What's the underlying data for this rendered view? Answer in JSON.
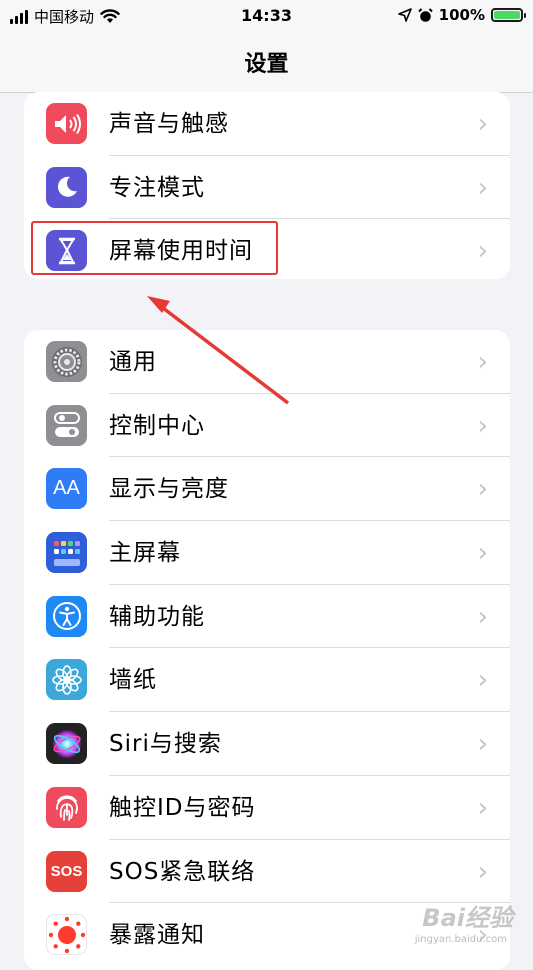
{
  "status_bar": {
    "carrier": "中国移动",
    "time": "14:33",
    "battery": "100%",
    "battery_level": 1.0
  },
  "nav": {
    "title": "设置"
  },
  "group1": [
    {
      "label": "声音与触感",
      "icon": "speaker-icon",
      "color": "#ef4b5c"
    },
    {
      "label": "专注模式",
      "icon": "moon-icon",
      "color": "#5b55d6"
    },
    {
      "label": "屏幕使用时间",
      "icon": "hourglass-icon",
      "color": "#5b55d6"
    }
  ],
  "group2": [
    {
      "label": "通用",
      "icon": "gear-icon",
      "color": "#8e8e93"
    },
    {
      "label": "控制中心",
      "icon": "toggles-icon",
      "color": "#8e8e93"
    },
    {
      "label": "显示与亮度",
      "icon": "aa-icon",
      "icon_text": "AA",
      "color": "#2f7cf6"
    },
    {
      "label": "主屏幕",
      "icon": "home-grid-icon",
      "color": "#2f5fd8"
    },
    {
      "label": "辅助功能",
      "icon": "accessibility-icon",
      "color": "#1e88f5"
    },
    {
      "label": "墙纸",
      "icon": "flower-icon",
      "color": "#3ca7d9"
    },
    {
      "label": "Siri与搜索",
      "icon": "siri-icon",
      "color": "#222222"
    },
    {
      "label": "触控ID与密码",
      "icon": "fingerprint-icon",
      "color": "#ef4b5c"
    },
    {
      "label": "SOS紧急联络",
      "icon": "sos-icon",
      "icon_text": "SOS",
      "color": "#e5413a"
    },
    {
      "label": "暴露通知",
      "icon": "exposure-icon",
      "color": "#ffffff"
    }
  ],
  "annotation": {
    "color": "#e53935"
  },
  "watermark": {
    "text": "Bai经验",
    "url": "jingyan.baidu.com"
  }
}
